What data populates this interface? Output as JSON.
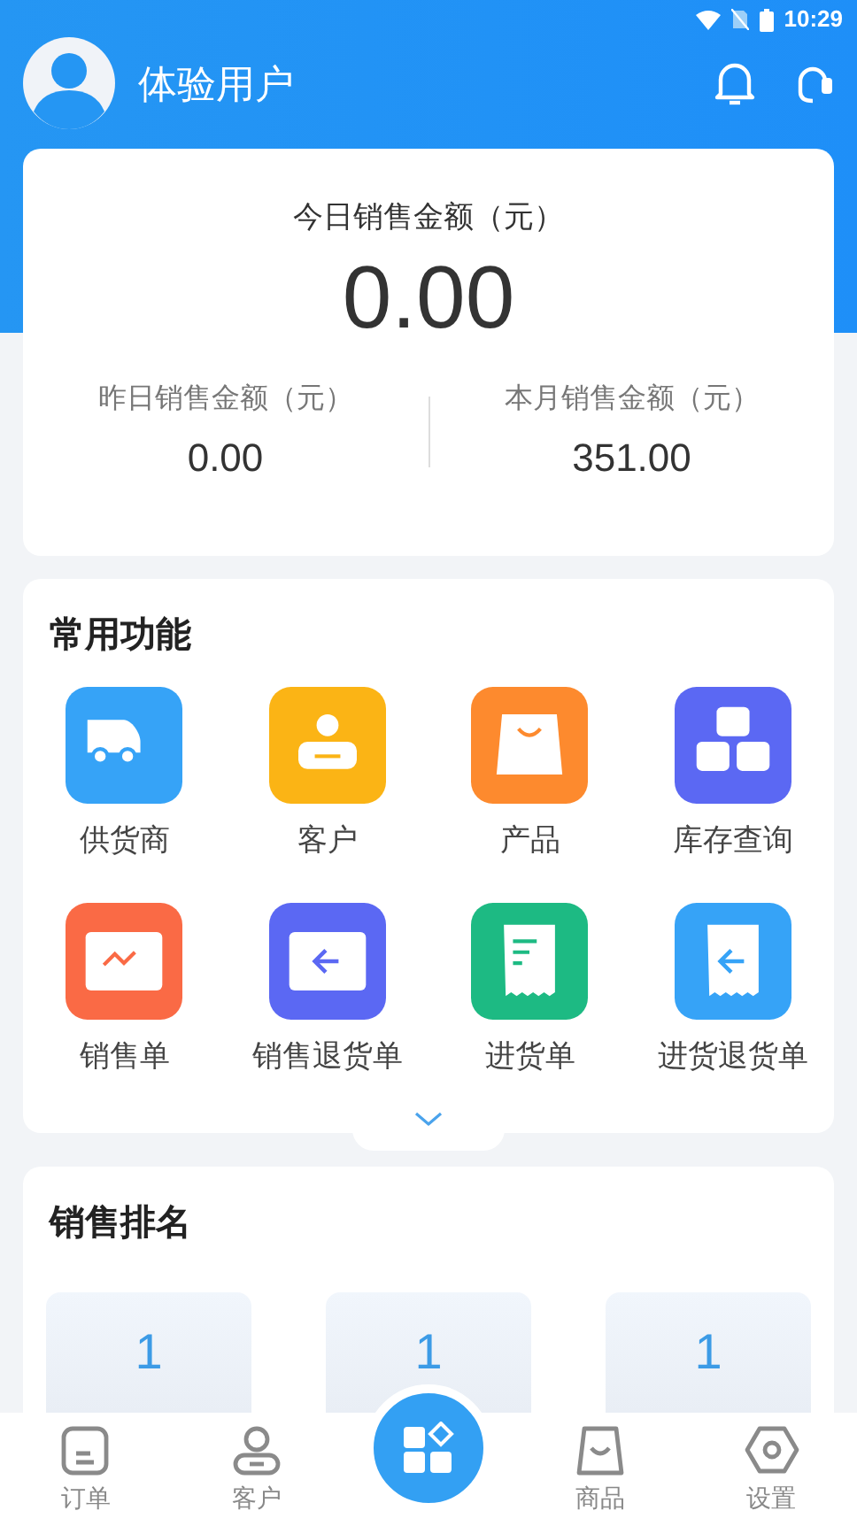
{
  "status_bar": {
    "time": "10:29"
  },
  "header": {
    "user_name": "体验用户"
  },
  "sales_summary": {
    "today_label": "今日销售金额（元）",
    "today_value": "0.00",
    "stats": [
      {
        "label": "昨日销售金额（元）",
        "value": "0.00"
      },
      {
        "label": "本月销售金额（元）",
        "value": "351.00"
      }
    ]
  },
  "functions": {
    "title": "常用功能",
    "items": [
      {
        "label": "供货商",
        "kind": "truck",
        "color": "#36a3f7"
      },
      {
        "label": "客户",
        "kind": "person",
        "color": "#fbb415"
      },
      {
        "label": "产品",
        "kind": "bag",
        "color": "#fd8a2e"
      },
      {
        "label": "库存查询",
        "kind": "boxes",
        "color": "#5b68f3"
      },
      {
        "label": "销售单",
        "kind": "chart",
        "color": "#fa6a45"
      },
      {
        "label": "销售退货单",
        "kind": "return",
        "color": "#5b68f3"
      },
      {
        "label": "进货单",
        "kind": "receipt",
        "color": "#1dba83"
      },
      {
        "label": "进货退货单",
        "kind": "receipt-return",
        "color": "#36a3f7"
      }
    ]
  },
  "ranking": {
    "title": "销售排名",
    "cards": [
      {
        "value": "1"
      },
      {
        "value": "1"
      },
      {
        "value": "1"
      }
    ]
  },
  "tab_bar": [
    {
      "label": "订单",
      "kind": "doc"
    },
    {
      "label": "客户",
      "kind": "person"
    },
    {
      "kind": "center"
    },
    {
      "label": "商品",
      "kind": "bag"
    },
    {
      "label": "设置",
      "kind": "gear"
    }
  ]
}
